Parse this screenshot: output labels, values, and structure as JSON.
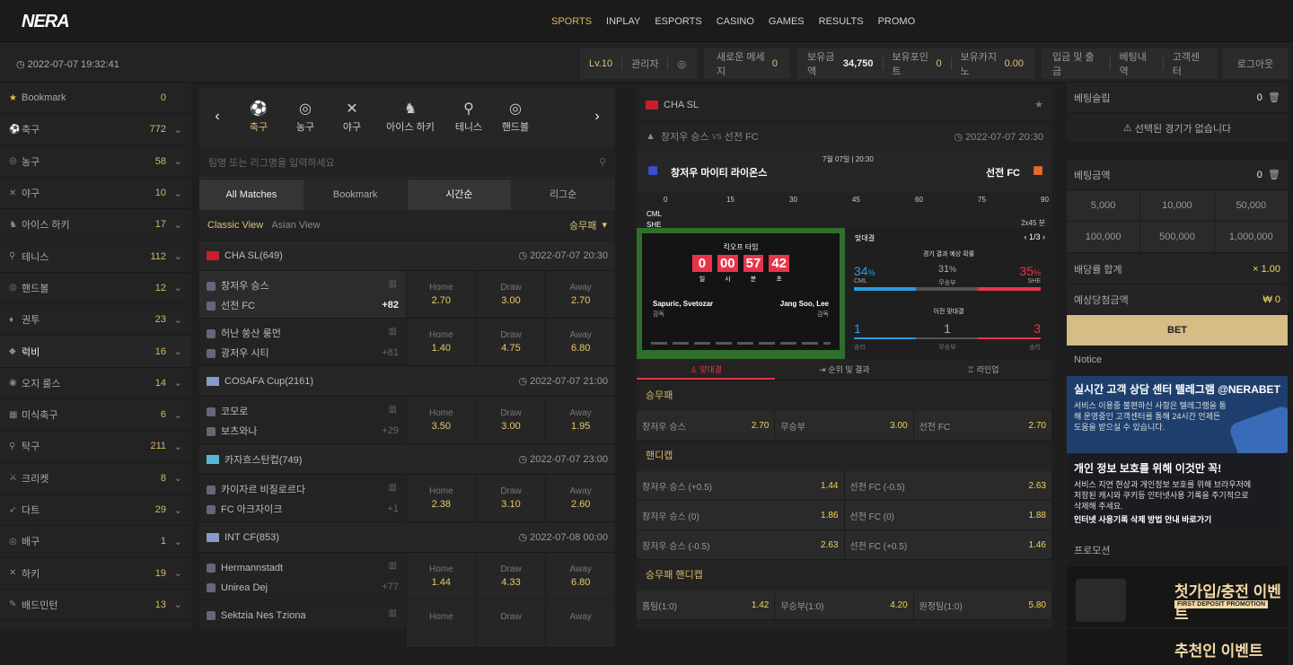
{
  "brand": {
    "logo_a": "NE",
    "logo_b": "RA"
  },
  "nav": [
    {
      "label": "SPORTS",
      "active": true
    },
    {
      "label": "INPLAY"
    },
    {
      "label": "ESPORTS"
    },
    {
      "label": "CASINO"
    },
    {
      "label": "GAMES"
    },
    {
      "label": "RESULTS"
    },
    {
      "label": "PROMO"
    }
  ],
  "clock": "2022-07-07 19:32:41",
  "user": {
    "level": "Lv.10",
    "name": "관리자",
    "messages_label": "새로운 메세지",
    "messages": "0",
    "money_label": "보유금액",
    "money": "34,750",
    "points_label": "보유포인트",
    "points": "0",
    "casino_label": "보유카지노",
    "casino": "0.00"
  },
  "menu": {
    "deposit": "입금 및 출금",
    "history": "베팅내역",
    "support": "고객센터",
    "logout": "로그아웃"
  },
  "sidebar": [
    {
      "icon": "★",
      "name": "Bookmark",
      "count": "0"
    },
    {
      "icon": "⚽",
      "name": "축구",
      "count": "772"
    },
    {
      "icon": "◎",
      "name": "농구",
      "count": "58"
    },
    {
      "icon": "✕",
      "name": "야구",
      "count": "10"
    },
    {
      "icon": "♞",
      "name": "아이스 하키",
      "count": "17"
    },
    {
      "icon": "⚲",
      "name": "테니스",
      "count": "112"
    },
    {
      "icon": "◎",
      "name": "핸드볼",
      "count": "12"
    },
    {
      "icon": "♦",
      "name": "권투",
      "count": "23"
    },
    {
      "icon": "◆",
      "name": "럭비",
      "count": "16",
      "selected": true
    },
    {
      "icon": "◉",
      "name": "오지 룰스",
      "count": "14"
    },
    {
      "icon": "▦",
      "name": "미식축구",
      "count": "6"
    },
    {
      "icon": "⚲",
      "name": "탁구",
      "count": "211"
    },
    {
      "icon": "⚔",
      "name": "크리켓",
      "count": "8"
    },
    {
      "icon": "➶",
      "name": "다트",
      "count": "29"
    },
    {
      "icon": "◎",
      "name": "배구",
      "count": "1"
    },
    {
      "icon": "✕",
      "name": "하키",
      "count": "19"
    },
    {
      "icon": "✎",
      "name": "배드민턴",
      "count": "13"
    }
  ],
  "sports_tabs": [
    {
      "icon": "⚽",
      "label": "축구",
      "active": true
    },
    {
      "icon": "◎",
      "label": "농구"
    },
    {
      "icon": "✕",
      "label": "야구"
    },
    {
      "icon": "♞",
      "label": "아이스 하키"
    },
    {
      "icon": "⚲",
      "label": "테니스"
    },
    {
      "icon": "◎",
      "label": "핸드볼"
    }
  ],
  "search_placeholder": "팀명 또는 리그명을 입력하세요",
  "filters": [
    "All Matches",
    "Bookmark",
    "시간순",
    "리그순"
  ],
  "views": {
    "classic": "Classic View",
    "asian": "Asian View",
    "market": "승무패"
  },
  "leagues": [
    {
      "name": "CHA SL(649)",
      "date": "2022-07-07 20:30",
      "flag": "#c8202a",
      "matches": [
        {
          "home": "창저우 승스",
          "away": "선전 FC",
          "plus": "+82",
          "odds": [
            "2.70",
            "3.00",
            "2.70"
          ],
          "highlight": true
        },
        {
          "home": "허난 쑹산 룽먼",
          "away": "광저우 시티",
          "plus": "+81",
          "odds": [
            "1.40",
            "4.75",
            "6.80"
          ]
        }
      ]
    },
    {
      "name": "COSAFA Cup(2161)",
      "date": "2022-07-07 21:00",
      "flag": "#8899cc",
      "matches": [
        {
          "home": "코모로",
          "away": "보츠와나",
          "plus": "+29",
          "odds": [
            "3.50",
            "3.00",
            "1.95"
          ]
        }
      ]
    },
    {
      "name": "카자흐스탄컵(749)",
      "date": "2022-07-07 23:00",
      "flag": "#5bb5d8",
      "matches": [
        {
          "home": "카이자르 비질로르다",
          "away": "FC 아크자이크",
          "plus": "+1",
          "odds": [
            "2.38",
            "3.10",
            "2.60"
          ]
        }
      ]
    },
    {
      "name": "INT CF(853)",
      "date": "2022-07-08 00:00",
      "flag": "#8899cc",
      "matches": [
        {
          "home": "Hermannstadt",
          "away": "Unirea Dej",
          "plus": "+77",
          "odds": [
            "1.44",
            "4.33",
            "6.80"
          ]
        },
        {
          "home": "Sektzia Nes Tziona",
          "away": "",
          "plus": "",
          "odds": [
            "",
            "",
            ""
          ]
        }
      ]
    }
  ],
  "odd_labels": [
    "Home",
    "Draw",
    "Away"
  ],
  "detail": {
    "league": "CHA SL",
    "home": "창저우 승스",
    "vs": "vs",
    "away": "선전 FC",
    "datetime": "2022-07-07 20:30",
    "home_full": "창저우 마이티 라이온스",
    "away_full": "선전 FC",
    "kickoff": "7월 07일 | 20:30",
    "ticks": [
      "0",
      "15",
      "30",
      "45",
      "60",
      "75",
      "90"
    ],
    "cml": "CML",
    "she": "SHE",
    "period": "2x45 분",
    "countdown_label": "킥오프 타임",
    "countdown": [
      "0",
      "00",
      "57",
      "42"
    ],
    "countdown_units": [
      "일",
      "시",
      "분",
      "초"
    ],
    "home_coach": "Sapuric, Svetozar",
    "away_coach": "Jang Soo, Lee",
    "coach_label": "감독",
    "h2h_label": "맞대결",
    "h2h_page": "1/3",
    "pred_label": "경기 결과 예상 확률",
    "pred": [
      {
        "v": "34",
        "u": "%",
        "t": "CML"
      },
      {
        "v": "31",
        "u": "%",
        "t": "무승부"
      },
      {
        "v": "35",
        "u": "%",
        "t": "SHE"
      }
    ],
    "prev_label": "이전 맞대결",
    "prev": [
      {
        "v": "1",
        "t": "승리"
      },
      {
        "v": "1",
        "t": "무승부"
      },
      {
        "v": "3",
        "t": "승리"
      }
    ],
    "tabs": [
      "맞대결",
      "순위 및 결과",
      "라인업"
    ]
  },
  "markets": [
    {
      "title": "승무패",
      "rows": [
        [
          [
            "창저우 승스",
            "2.70"
          ],
          [
            "무승부",
            "3.00"
          ],
          [
            "선전 FC",
            "2.70"
          ]
        ]
      ]
    },
    {
      "title": "핸디캡",
      "rows": [
        [
          [
            "창저우 승스 (+0.5)",
            "1.44"
          ],
          [
            "선전 FC (-0.5)",
            "2.63"
          ]
        ],
        [
          [
            "창저우 승스 (0)",
            "1.86"
          ],
          [
            "선전 FC (0)",
            "1.88"
          ]
        ],
        [
          [
            "창저우 승스 (-0.5)",
            "2.63"
          ],
          [
            "선전 FC (+0.5)",
            "1.46"
          ]
        ]
      ]
    },
    {
      "title": "승무패 핸디캡",
      "rows": [
        [
          [
            "홈팀(1:0)",
            "1.42"
          ],
          [
            "무승부(1:0)",
            "4.20"
          ],
          [
            "원정팀(1:0)",
            "5.80"
          ]
        ]
      ]
    }
  ],
  "slip": {
    "title": "베팅슬립",
    "count": "0",
    "empty": "선택된 경기가 없습니다",
    "amount_label": "베팅금액",
    "amount": "0",
    "amounts": [
      "5,000",
      "10,000",
      "50,000",
      "100,000",
      "500,000",
      "1,000,000"
    ],
    "odds_label": "배당률 합계",
    "odds": "× 1.00",
    "win_label": "예상당첨금액",
    "win": "₩ 0",
    "bet": "BET",
    "notice": "Notice",
    "promo": "프로모션"
  },
  "banner1": {
    "h": "실시간 고객 상담 센터 텔레그램 @NERABET",
    "b": "서비스 이용중 불편하신 사항은 텔레그램을 통해 운영중인 고객센터를 통해 24시간 언제든 도움을 받으실 수 있습니다."
  },
  "banner2": {
    "h": "개인 정보 보호를 위해 이것만 꼭!",
    "b": "서비스 지연 현상과 개인정보 보호를 위해 브라우저에 저장된 캐시와 쿠키등 인터넷사용 기록을 주기적으로 삭제해 주세요.",
    "c": "인터넷 사용기록 삭제 방법 안내 바로가기"
  },
  "promo1": {
    "h": "첫가입/충전 이벤트",
    "s": "FIRST DEPOSIT PROMOTION"
  },
  "promo2": {
    "h": "추천인 이벤트"
  }
}
